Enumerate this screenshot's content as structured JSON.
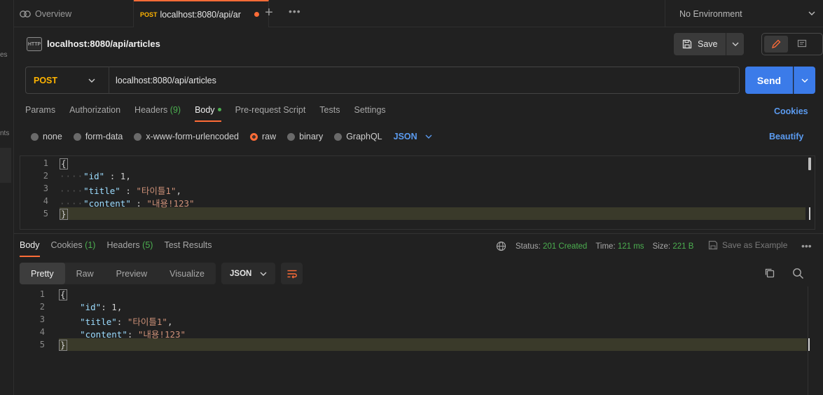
{
  "left_strip": {
    "frag_1": "es",
    "frag_2": "nts"
  },
  "tabs": {
    "overview_label": "Overview",
    "active_method": "POST",
    "active_url": "localhost:8080/api/ar",
    "environment": "No Environment"
  },
  "request": {
    "icon_text": "HTTP",
    "name": "localhost:8080/api/articles",
    "save_label": "Save",
    "method": "POST",
    "url": "localhost:8080/api/articles",
    "send_label": "Send",
    "tabs": [
      {
        "label": "Params",
        "count": ""
      },
      {
        "label": "Authorization",
        "count": ""
      },
      {
        "label": "Headers",
        "count": "(9)"
      },
      {
        "label": "Body",
        "count": ""
      },
      {
        "label": "Pre-request Script",
        "count": ""
      },
      {
        "label": "Tests",
        "count": ""
      },
      {
        "label": "Settings",
        "count": ""
      }
    ],
    "cookies_label": "Cookies",
    "body_types": [
      "none",
      "form-data",
      "x-www-form-urlencoded",
      "raw",
      "binary",
      "GraphQL"
    ],
    "body_type_selected": "raw",
    "body_format": "JSON",
    "beautify_label": "Beautify",
    "body_lines": {
      "n1": "1",
      "n2": "2",
      "n3": "3",
      "n4": "4",
      "n5": "5",
      "l1": "{",
      "k2": "\"id\"",
      "v2": "1",
      "k3": "\"title\"",
      "v3": "\"타이틀1\"",
      "k4": "\"content\"",
      "v4": "\"내용!123\"",
      "l5": "}"
    }
  },
  "response": {
    "tabs": [
      {
        "label": "Body",
        "count": ""
      },
      {
        "label": "Cookies",
        "count": "(1)"
      },
      {
        "label": "Headers",
        "count": "(5)"
      },
      {
        "label": "Test Results",
        "count": ""
      }
    ],
    "status_label": "Status:",
    "status_value": "201 Created",
    "time_label": "Time:",
    "time_value": "121 ms",
    "size_label": "Size:",
    "size_value": "221 B",
    "save_example_label": "Save as Example",
    "views": [
      "Pretty",
      "Raw",
      "Preview",
      "Visualize"
    ],
    "format": "JSON",
    "body_lines": {
      "n1": "1",
      "n2": "2",
      "n3": "3",
      "n4": "4",
      "n5": "5",
      "l1": "{",
      "k2": "\"id\"",
      "v2": "1",
      "k3": "\"title\"",
      "v3": "\"타이틀1\"",
      "k4": "\"content\"",
      "v4": "\"내용!123\"",
      "l5": "}"
    }
  },
  "colors": {
    "accent": "#ff6c37",
    "method": "#ffb400",
    "link": "#5b9bf0",
    "send": "#3b7be9",
    "success": "#4caf50"
  }
}
